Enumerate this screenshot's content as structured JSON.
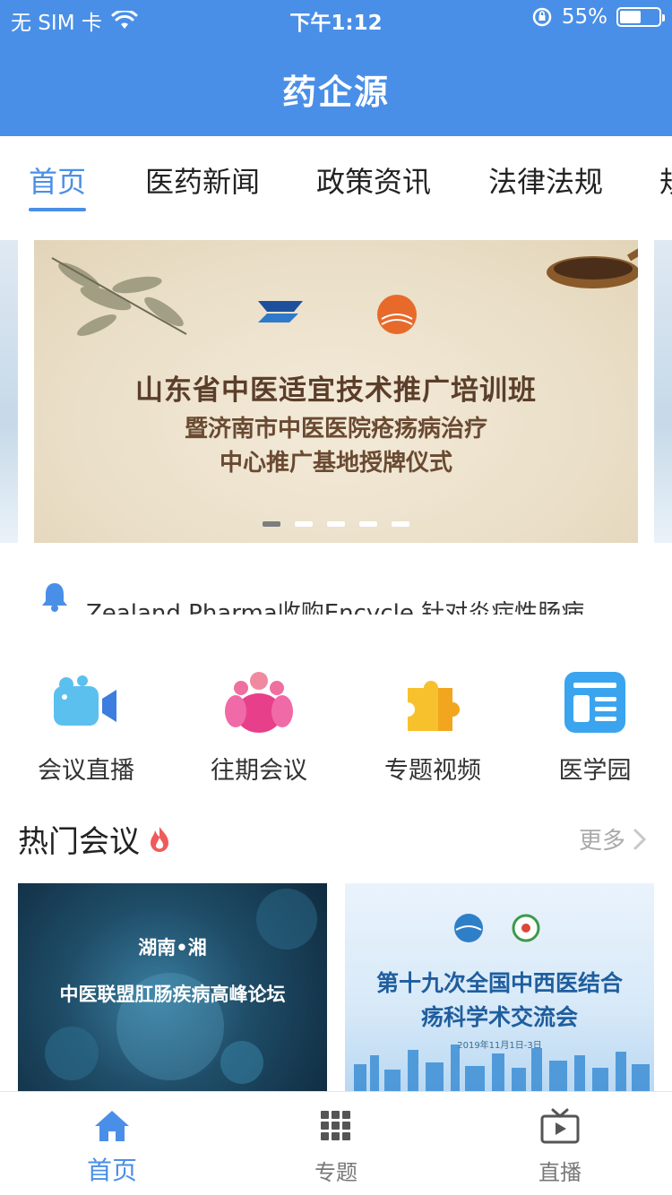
{
  "status_bar": {
    "carrier": "无 SIM 卡",
    "time": "下午1:12",
    "battery": "55%",
    "battery_level": 0.55
  },
  "header": {
    "title": "药企源"
  },
  "tabs": [
    {
      "label": "首页",
      "active": true
    },
    {
      "label": "医药新闻"
    },
    {
      "label": "政策资讯"
    },
    {
      "label": "法律法规"
    },
    {
      "label": "规"
    }
  ],
  "banner": {
    "line1": "山东省中医适宜技术推广培训班",
    "line2": "暨济南市中医医院疮疡病治疗",
    "line3": "中心推广基地授牌仪式",
    "page_count": 5,
    "active_index": 0
  },
  "notice": {
    "icon": "bell-icon",
    "text": "Zealand Pharma收购Encycle 针对炎症性肠病"
  },
  "entries": [
    {
      "label": "会议直播",
      "icon": "video-camera-icon"
    },
    {
      "label": "往期会议",
      "icon": "people-group-icon"
    },
    {
      "label": "专题视频",
      "icon": "puzzle-icon"
    },
    {
      "label": "医学园",
      "icon": "newspaper-icon"
    }
  ],
  "hot_section": {
    "title": "热门会议",
    "more": "更多",
    "cards": [
      {
        "title_top": "湖南•湘",
        "title_main": "中医联盟肛肠疾病高峰论坛"
      },
      {
        "title_line1": "第十九次全国中西医结合",
        "title_line2": "疡科学术交流会",
        "date": "2019年11月1日-3日"
      }
    ]
  },
  "tabbar": [
    {
      "label": "首页",
      "icon": "home-icon",
      "active": true
    },
    {
      "label": "专题",
      "icon": "grid-icon"
    },
    {
      "label": "直播",
      "icon": "tv-icon"
    }
  ],
  "colors": {
    "primary": "#4a8fe7",
    "hot_flame": "#f05a5a"
  }
}
